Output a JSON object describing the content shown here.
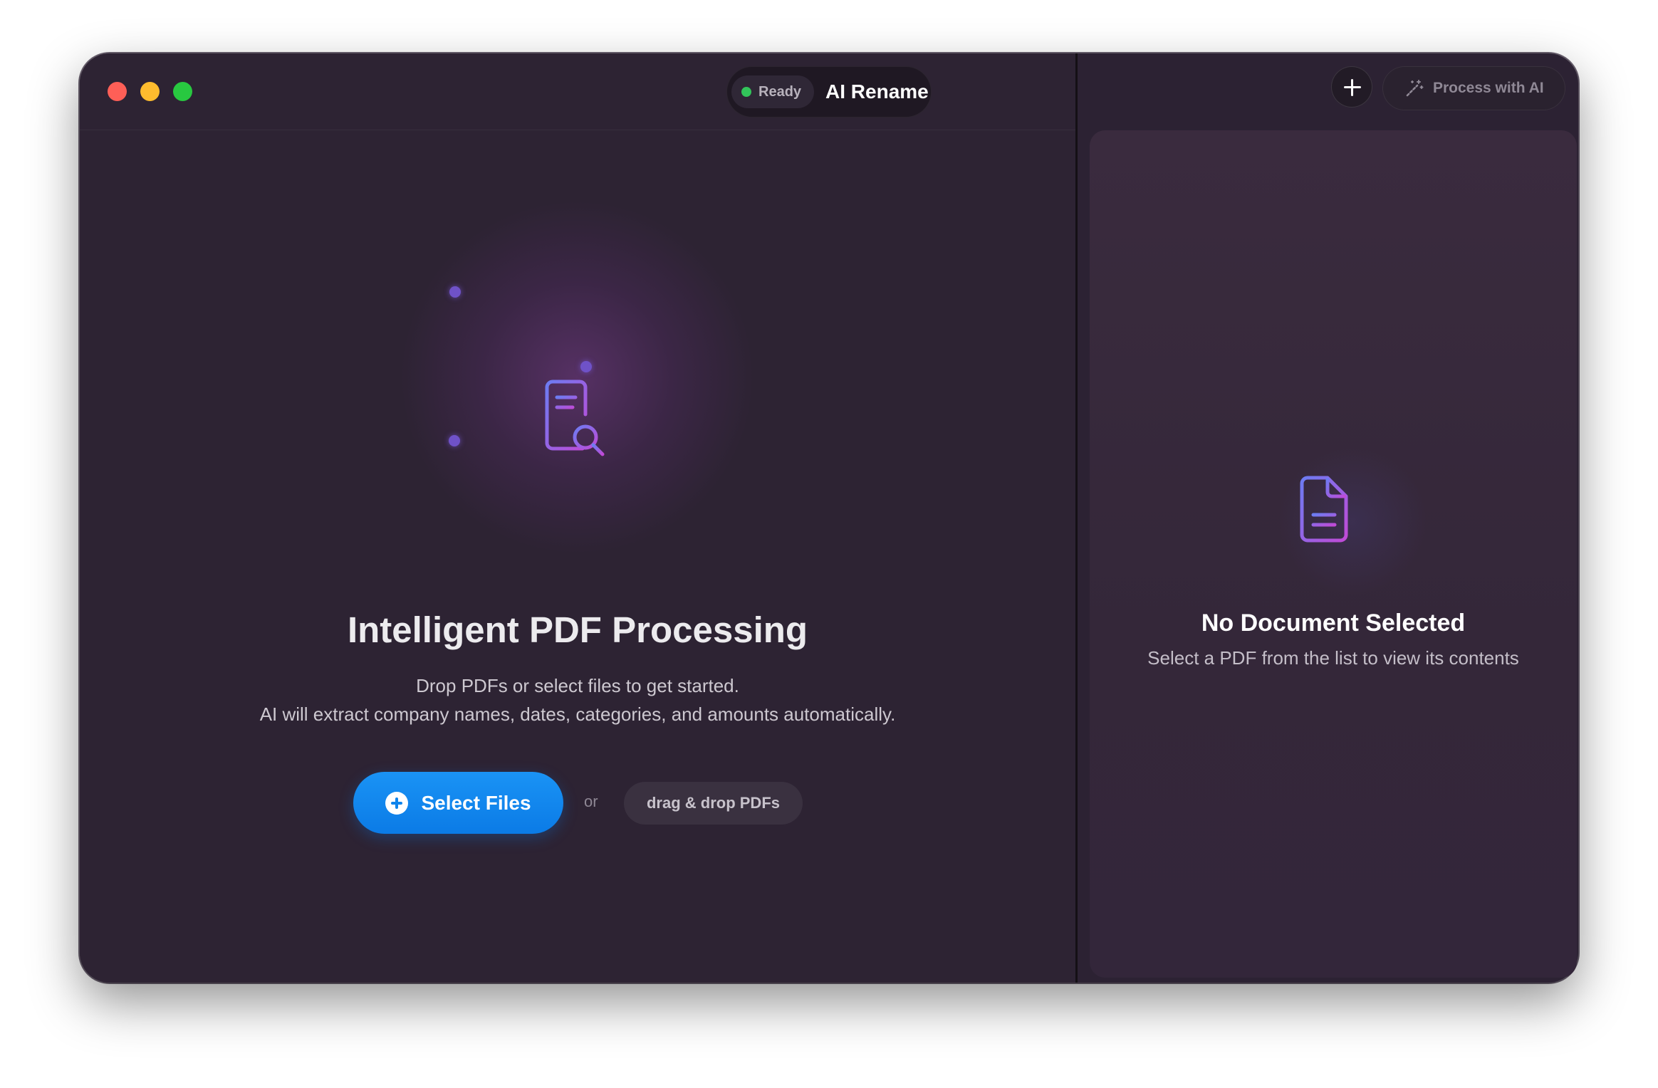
{
  "window": {
    "app_title": "AI Rename",
    "status": "Ready",
    "status_color": "#32c45a"
  },
  "toolbar": {
    "add_icon": "plus-icon",
    "process_label": "Process with AI",
    "process_icon": "magic-wand-icon"
  },
  "empty_state": {
    "icon": "document-search-icon",
    "title": "Intelligent PDF Processing",
    "subtitle_line1": "Drop PDFs or select files to get started.",
    "subtitle_line2": "AI will extract company names, dates, categories, and amounts automatically.",
    "select_button_label": "Select Files",
    "separator": "or",
    "drag_drop_label": "drag & drop PDFs"
  },
  "preview": {
    "icon": "document-icon",
    "title": "No Document Selected",
    "subtitle": "Select a PDF from the list to view its contents"
  },
  "colors": {
    "accent_blue": "#0f84ec",
    "icon_gradient_start": "#6c7cf2",
    "icon_gradient_end": "#c04ad6"
  }
}
